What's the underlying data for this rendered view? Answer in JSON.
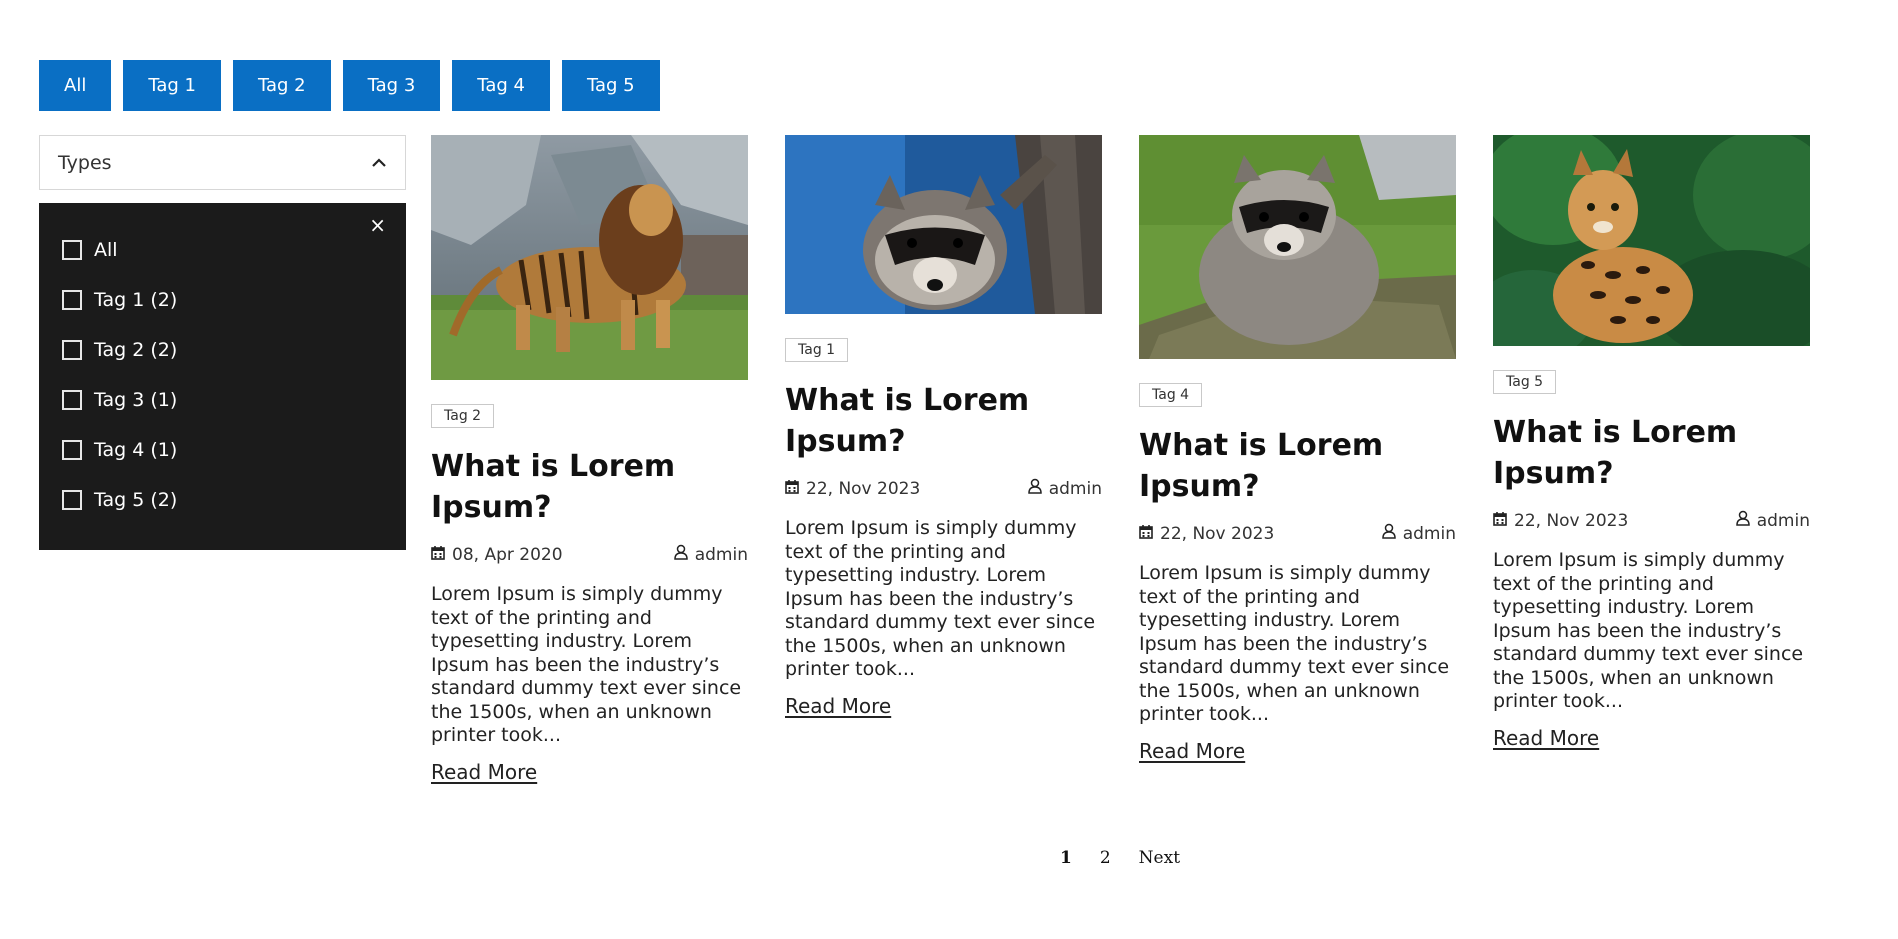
{
  "tag_buttons": [
    "All",
    "Tag 1",
    "Tag 2",
    "Tag 3",
    "Tag 4",
    "Tag 5"
  ],
  "types_dropdown": {
    "label": "Types",
    "close_symbol": "×",
    "options": [
      "All",
      "Tag 1 (2)",
      "Tag 2 (2)",
      "Tag 3 (1)",
      "Tag 4 (1)",
      "Tag 5 (2)"
    ]
  },
  "posts": [
    {
      "image": "lion-tiger-photo",
      "tag": "Tag 2",
      "title_line1": "What is Lorem",
      "title_line2": "Ipsum?",
      "date": "08, Apr 2020",
      "author": "admin",
      "excerpt": "Lorem Ipsum is simply dummy text of the printing and typesetting industry. Lorem Ipsum has been the industry’s standard dummy text ever since the 1500s, when an unknown printer took...",
      "read_more": "Read More"
    },
    {
      "image": "raccoon-tree-photo",
      "tag": "Tag 1",
      "title_line1": "What is Lorem",
      "title_line2": "Ipsum?",
      "date": "22, Nov 2023",
      "author": "admin",
      "excerpt": "Lorem Ipsum is simply dummy text of the printing and typesetting industry. Lorem Ipsum has been the industry’s standard dummy text ever since the 1500s, when an unknown printer took...",
      "read_more": "Read More"
    },
    {
      "image": "raccoon-grass-photo",
      "tag": "Tag 4",
      "title_line1": "What is Lorem",
      "title_line2": "Ipsum?",
      "date": "22, Nov 2023",
      "author": "admin",
      "excerpt": "Lorem Ipsum is simply dummy text of the printing and typesetting industry. Lorem Ipsum has been the industry’s standard dummy text ever since the 1500s, when an unknown printer took...",
      "read_more": "Read More"
    },
    {
      "image": "ocelot-photo",
      "tag": "Tag 5",
      "title_line1": "What is Lorem",
      "title_line2": "Ipsum?",
      "date": "22, Nov 2023",
      "author": "admin",
      "excerpt": "Lorem Ipsum is simply dummy text of the printing and typesetting industry. Lorem Ipsum has been the industry’s standard dummy text ever since the 1500s, when an unknown printer took...",
      "read_more": "Read More"
    }
  ],
  "pagination": {
    "page1": "1",
    "page2": "2",
    "next": "Next"
  },
  "colors": {
    "tag_button_bg": "#0a6fc4",
    "filter_panel_bg": "#1b1b1b"
  }
}
